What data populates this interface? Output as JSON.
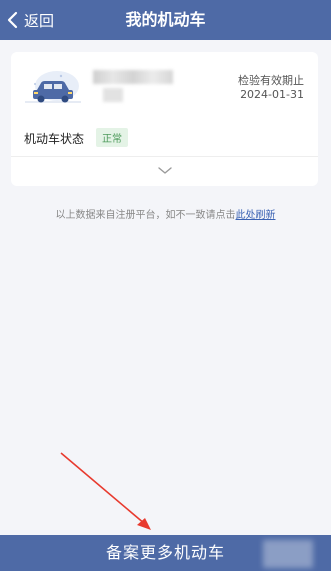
{
  "header": {
    "back_label": "返回",
    "title": "我的机动车"
  },
  "vehicle_card": {
    "icon": "car-icon",
    "inspection_label": "检验有效期止",
    "inspection_date": "2024-01-31",
    "status_label": "机动车状态",
    "status_value": "正常",
    "expand_icon": "chevron-down-icon"
  },
  "notice": {
    "text": "以上数据来自注册平台，如不一致请点击",
    "link": "此处刷新"
  },
  "footer": {
    "button_label": "备案更多机动车"
  },
  "colors": {
    "header_bg": "#4e6aa6",
    "page_bg": "#f4f5f9",
    "status_green": "#4c9a5a",
    "link_blue": "#3a62b3",
    "annotation_red": "#e83a2e"
  }
}
